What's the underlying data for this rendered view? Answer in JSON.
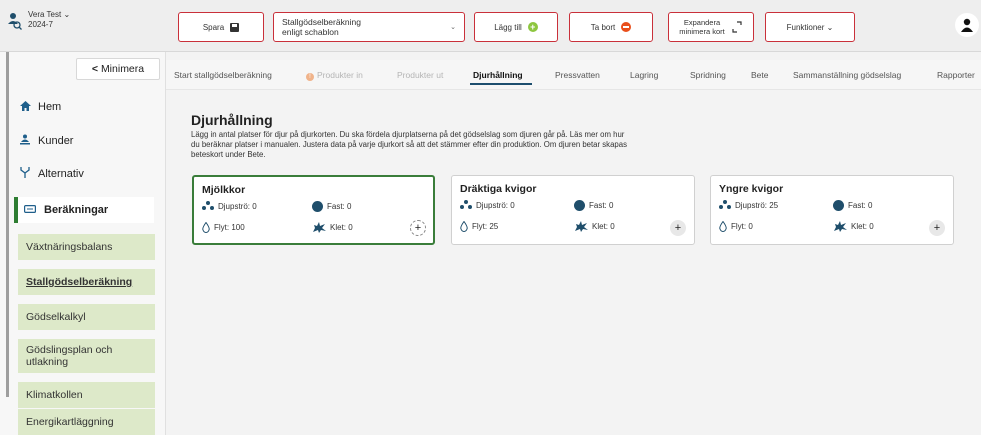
{
  "header": {
    "user_name": "Vera Test",
    "user_year": "2024-7",
    "save_label": "Spara",
    "calc_select_line1": "Stallgödselberäkning",
    "calc_select_line2": "enligt schablon",
    "add_label": "Lägg till",
    "delete_label": "Ta bort",
    "expand_line1": "Expandera",
    "expand_line2": "minimera kort",
    "functions_label": "Funktioner",
    "chevron": "⌄",
    "icons": {
      "user": "user-icon",
      "save": "floppy-icon",
      "add": "plus-circle-icon",
      "delete": "minus-circle-icon",
      "expand": "expand-icon",
      "avatar": "avatar-icon"
    }
  },
  "sidebar": {
    "minimize_label": "Minimera",
    "minimize_chevron": "<",
    "items": [
      {
        "label": "Hem",
        "icon": "home-icon"
      },
      {
        "label": "Kunder",
        "icon": "customers-icon"
      },
      {
        "label": "Alternativ",
        "icon": "branch-icon"
      },
      {
        "label": "Beräkningar",
        "icon": "calculator-icon"
      }
    ],
    "sub_items": [
      {
        "label": "Växtnäringsbalans"
      },
      {
        "label": "Stallgödselberäkning"
      },
      {
        "label": "Gödselkalkyl"
      },
      {
        "label": "Gödslingsplan och utlakning"
      },
      {
        "label": "Klimatkollen"
      },
      {
        "label": "Energikartläggning"
      }
    ],
    "accent_color": "#2e7d32",
    "sub_bg": "#dde9c9"
  },
  "tabs": [
    {
      "label": "Start stallgödselberäkning",
      "state": "normal"
    },
    {
      "label": "Produkter in",
      "state": "disabled",
      "warning": "!"
    },
    {
      "label": "Produkter ut",
      "state": "disabled"
    },
    {
      "label": "Djurhållning",
      "state": "active"
    },
    {
      "label": "Pressvatten",
      "state": "normal"
    },
    {
      "label": "Lagring",
      "state": "normal"
    },
    {
      "label": "Spridning",
      "state": "normal"
    },
    {
      "label": "Bete",
      "state": "normal"
    },
    {
      "label": "Sammanställning gödselslag",
      "state": "normal"
    },
    {
      "label": "Rapporter",
      "state": "normal"
    }
  ],
  "main": {
    "title": "Djurhållning",
    "description": "Lägg in antal platser för djur på djurkorten. Du ska fördela djurplatserna på det gödselslag som djuren går på. Läs mer om hur du beräknar platser i manualen. Justera data på varje djurkort så att det stämmer efter din produktion. Om djuren betar skapas beteskort under Bete.",
    "cards": [
      {
        "title": "Mjölkkor",
        "djupstro": "Djupströ: 0",
        "fast": "Fast: 0",
        "flyt": "Flyt: 100",
        "klet": "Klet: 0",
        "selected": true
      },
      {
        "title": "Dräktiga kvigor",
        "djupstro": "Djupströ: 0",
        "fast": "Fast: 0",
        "flyt": "Flyt: 25",
        "klet": "Klet: 0",
        "selected": false
      },
      {
        "title": "Yngre kvigor",
        "djupstro": "Djupströ: 25",
        "fast": "Fast: 0",
        "flyt": "Flyt: 0",
        "klet": "Klet: 0",
        "selected": false
      }
    ],
    "add_symbol": "+"
  },
  "colors": {
    "button_border": "#c9303a",
    "selected_card": "#3a7d3a",
    "icon_dark": "#1f4e6b",
    "tab_underline": "#1d4e6e"
  }
}
